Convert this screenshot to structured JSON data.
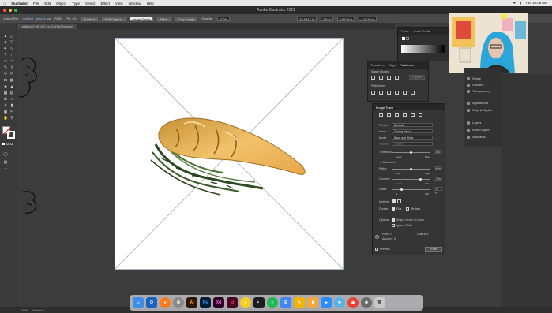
{
  "menubar": {
    "app": "Illustrator",
    "items": [
      "File",
      "Edit",
      "Object",
      "Type",
      "Select",
      "Effect",
      "View",
      "Window",
      "Help"
    ],
    "clock": "Tue 10:06 AM"
  },
  "window": {
    "title": "Adobe Illustrator 2021"
  },
  "control_bar": {
    "linked_file": "Linked File",
    "file_name": "Untitled_Artwork.jpg",
    "rgb": "RGB",
    "ppi": "PPI: 617",
    "embed": "Embed",
    "edit_original": "Edit Original",
    "image_trace": "Image Trace",
    "mask": "Mask",
    "crop_image": "Crop Image",
    "opacity_label": "Opacity:",
    "opacity_value": "100%",
    "x_value": "15.6947 in",
    "y_value": "2.5 in",
    "w_value": "4.9129 in",
    "h_value": "4.9129 in"
  },
  "document_tab": {
    "label": "Untitled-1* @ 150 % (CMYK/Preview)"
  },
  "color_panel": {
    "tab1": "Color",
    "tab2": "Color Guide"
  },
  "pathfinder_panel": {
    "tabs": [
      "Transform",
      "Align",
      "Pathfinder"
    ],
    "shape_modes": "Shape Modes:",
    "expand": "Expand",
    "pathfinders": "Pathfinders:"
  },
  "image_trace_panel": {
    "title": "Image Trace",
    "preset_label": "Preset:",
    "preset_value": "[Default]",
    "view_label": "View:",
    "view_value": "Tracing Result",
    "mode_label": "Mode:",
    "mode_value": "Black and White",
    "palette_label": "Palette:",
    "palette_value": "Limited",
    "threshold_label": "Threshold:",
    "threshold_value": "128",
    "threshold_less": "Less",
    "threshold_more": "More",
    "advanced": "Advanced",
    "paths_label": "Paths:",
    "paths_value": "50%",
    "paths_low": "Low",
    "paths_high": "High",
    "corners_label": "Corners:",
    "corners_value": "75%",
    "corners_less": "Less",
    "corners_more": "More",
    "noise_label": "Noise:",
    "noise_value": "25 px",
    "noise_min": "1",
    "noise_max": "100",
    "method_label": "Method:",
    "create_label": "Create:",
    "fills": "Fills",
    "strokes": "Strokes",
    "options_label": "Options:",
    "snap_curves": "Snap Curves To Lines",
    "ignore_white": "Ignore White",
    "paths_stat": "Paths: 0",
    "colors_stat": "Colors: 0",
    "anchors_stat": "Anchors: 0",
    "preview": "Preview",
    "trace": "Trace",
    "threshold_fraction": 0.5,
    "paths_fraction": 0.5,
    "corners_fraction": 0.75,
    "noise_fraction": 0.25
  },
  "side_panels": {
    "items": [
      "Stroke",
      "Gradient",
      "Transparency",
      "Appearance",
      "Graphic Styles",
      "Layers",
      "Asset Export",
      "Artboards"
    ]
  },
  "status_bar": {
    "zoom": "150%",
    "tool": "Selection"
  },
  "dock": {
    "apps": [
      "Finder",
      "Outlook",
      "Firefox",
      "Settings",
      "Ai",
      "Ps",
      "Xd",
      "Id",
      "Duck",
      "Terminal",
      "Spotify",
      "Docs",
      "Notes",
      "Slides",
      "Zoom",
      "Safari",
      "Chrome",
      "Photos",
      "Trash"
    ]
  }
}
